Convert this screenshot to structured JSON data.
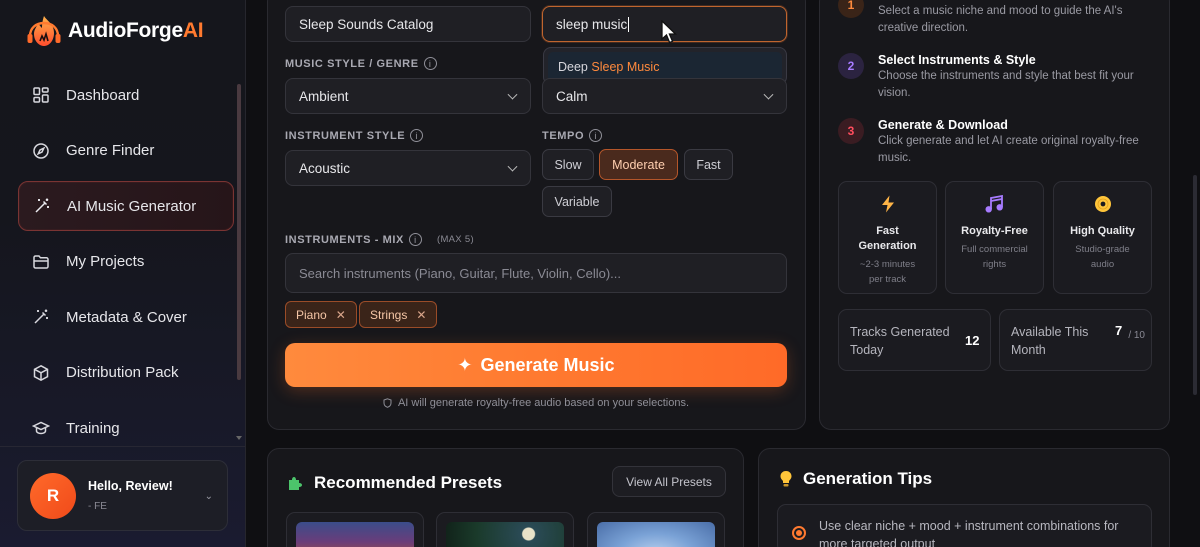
{
  "brand": {
    "name": "AudioForge",
    "suffix": "AI"
  },
  "sidebar": {
    "items": [
      {
        "label": "Dashboard",
        "icon": "grid-icon"
      },
      {
        "label": "Genre Finder",
        "icon": "compass-icon"
      },
      {
        "label": "AI Music Generator",
        "icon": "magic-wand-icon",
        "active": true
      },
      {
        "label": "My Projects",
        "icon": "folder-icon"
      },
      {
        "label": "Metadata & Cover",
        "icon": "magic-wand-icon"
      },
      {
        "label": "Distribution Pack",
        "icon": "box-icon"
      },
      {
        "label": "Training",
        "icon": "graduation-cap-icon"
      }
    ]
  },
  "user": {
    "initial": "R",
    "greeting": "Hello, Review!",
    "sub": "- FE"
  },
  "form": {
    "project_name": "Sleep Sounds Catalog",
    "niche_input": "sleep music",
    "suggestion": {
      "prefix": "Deep ",
      "match": "Sleep Music"
    },
    "style_label": "MUSIC STYLE / GENRE",
    "style_value": "Ambient",
    "mood_value": "Calm",
    "instrument_style_label": "INSTRUMENT STYLE",
    "instrument_style_value": "Acoustic",
    "tempo_label": "TEMPO",
    "tempo_options": [
      "Slow",
      "Moderate",
      "Fast",
      "Variable"
    ],
    "tempo_selected": "Moderate",
    "mix_label": "INSTRUMENTS - MIX",
    "mix_max": "(MAX 5)",
    "mix_placeholder": "Search instruments (Piano, Guitar, Flute, Violin, Cello)...",
    "mix_tags": [
      "Piano",
      "Strings"
    ],
    "generate_label": "Generate Music",
    "generate_note": "AI will generate royalty-free audio based on your selections."
  },
  "steps": [
    {
      "num": "1",
      "title": "",
      "desc": "Select a music niche and mood to guide the AI's creative direction.",
      "color": "#ff7a30"
    },
    {
      "num": "2",
      "title": "Select Instruments & Style",
      "desc": "Choose the instruments and style that best fit your vision.",
      "color": "#9b6bff"
    },
    {
      "num": "3",
      "title": "Generate & Download",
      "desc": "Click generate and let AI create original royalty-free music.",
      "color": "#ff4d5e"
    }
  ],
  "features": [
    {
      "title": "Fast Generation",
      "desc": "~2-3 minutes per track",
      "icon": "lightning-icon",
      "color": "#ffb547"
    },
    {
      "title": "Royalty-Free",
      "desc": "Full commercial rights",
      "icon": "music-notes-icon",
      "color": "#a77bff"
    },
    {
      "title": "High Quality",
      "desc": "Studio-grade audio",
      "icon": "disc-icon",
      "color": "#ffc53a"
    }
  ],
  "stats": {
    "tracks_label": "Tracks Generated Today",
    "tracks_value": "12",
    "available_label": "Available This Month",
    "available_value": "7",
    "available_max": "/ 10"
  },
  "presets": {
    "title": "Recommended Presets",
    "view_all": "View All Presets"
  },
  "tips": {
    "title": "Generation Tips",
    "first": "Use clear niche + mood + instrument combinations for more targeted output"
  }
}
